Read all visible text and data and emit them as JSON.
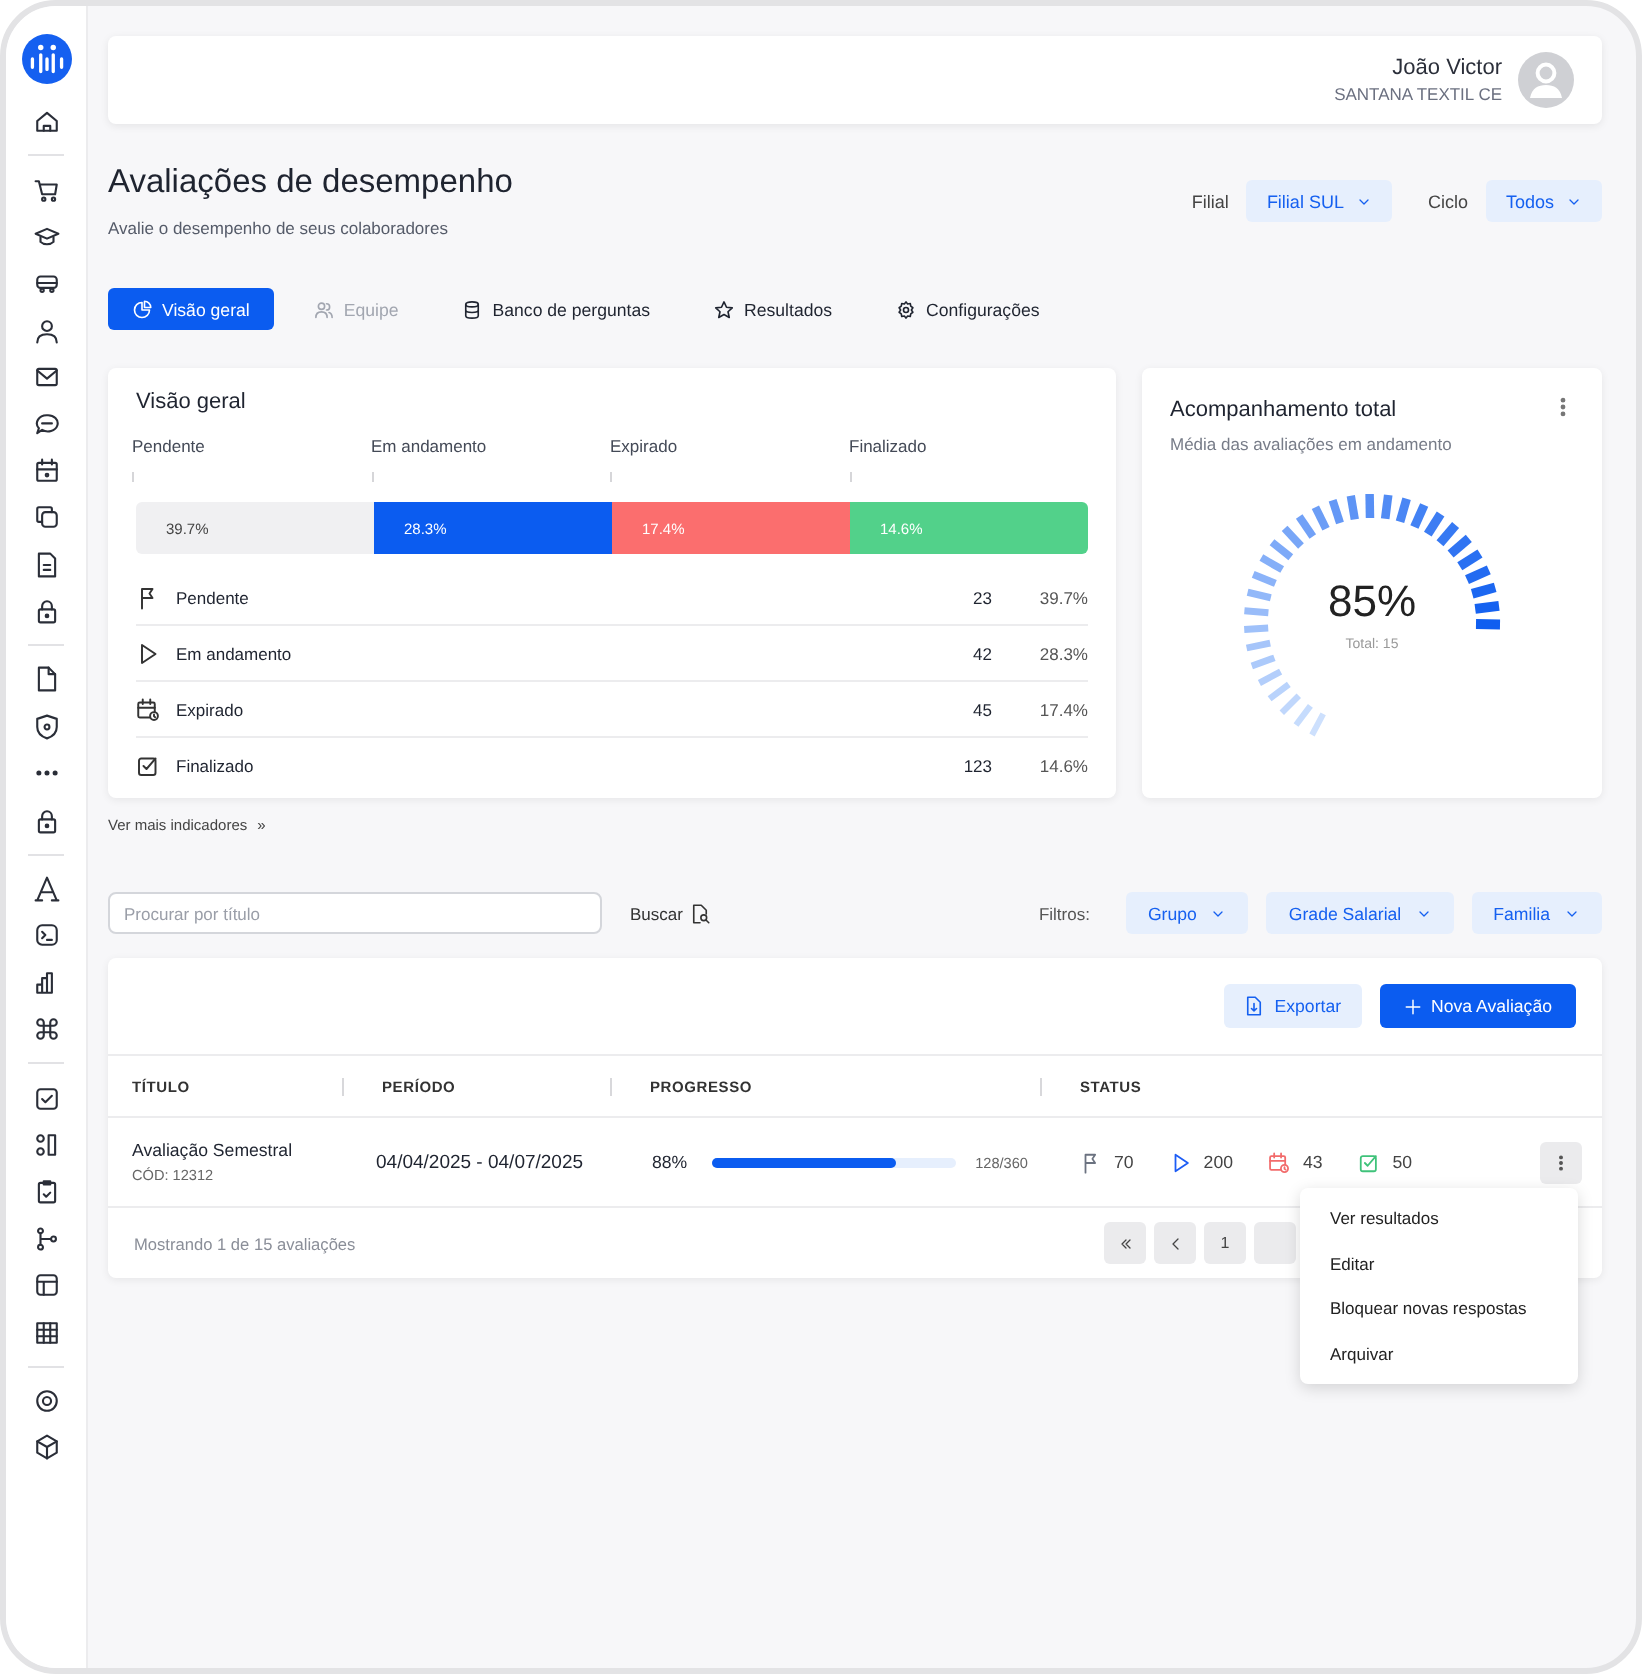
{
  "user": {
    "name": "João Victor",
    "company": "SANTANA TEXTIL CE"
  },
  "page": {
    "title": "Avaliações de desempenho",
    "subtitle": "Avalie o desempenho de seus colaboradores"
  },
  "selectors": [
    {
      "label": "Filial",
      "value": "Filial SUL"
    },
    {
      "label": "Ciclo",
      "value": "Todos"
    }
  ],
  "tabs": [
    {
      "label": "Visão geral",
      "selected": true,
      "disabled": false
    },
    {
      "label": "Equipe",
      "selected": false,
      "disabled": true
    },
    {
      "label": "Banco de perguntas",
      "selected": false,
      "disabled": false
    },
    {
      "label": "Resultados",
      "selected": false,
      "disabled": false
    },
    {
      "label": "Configurações",
      "selected": false,
      "disabled": false
    }
  ],
  "overview": {
    "title": "Visão geral",
    "segments": [
      {
        "label": "Pendente",
        "value": "39.7%",
        "color": "#f0f0f2"
      },
      {
        "label": "Em andamento",
        "value": "28.3%",
        "color": "#0b5cf0"
      },
      {
        "label": "Expirado",
        "value": "17.4%",
        "color": "#fb6e6e"
      },
      {
        "label": "Finalizado",
        "value": "14.6%",
        "color": "#52d18a"
      }
    ],
    "rows": [
      {
        "label": "Pendente",
        "count": "23",
        "percent": "39.7%"
      },
      {
        "label": "Em andamento",
        "count": "42",
        "percent": "28.3%"
      },
      {
        "label": "Expirado",
        "count": "45",
        "percent": "17.4%"
      },
      {
        "label": "Finalizado",
        "count": "123",
        "percent": "14.6%"
      }
    ]
  },
  "more_link": {
    "label": "Ver mais indicadores",
    "arrow": "»"
  },
  "tracking": {
    "title": "Acompanhamento total",
    "subtitle": "Média das avaliações em andamento",
    "value": "85%",
    "total": "Total: 15"
  },
  "search": {
    "placeholder": "Procurar por título",
    "button": "Buscar"
  },
  "filters": {
    "label": "Filtros:",
    "items": [
      "Grupo",
      "Grade Salarial",
      "Familia"
    ]
  },
  "table": {
    "actions": [
      {
        "label": "Exportar",
        "kind": "secondary"
      },
      {
        "label": "Nova Avaliação",
        "kind": "primary"
      }
    ],
    "columns": [
      "TÍTULO",
      "PERÍODO",
      "PROGRESSO",
      "STATUS"
    ],
    "rows": [
      {
        "title": "Avaliação Semestral",
        "code": "CÓD: 12312",
        "period": "04/04/2025 - 04/07/2025",
        "progress": "88%",
        "level": 0.76,
        "ratio": "128/360",
        "status": [
          {
            "count": "70",
            "color": "#6b7280"
          },
          {
            "count": "200",
            "color": "#1d5df5"
          },
          {
            "count": "43",
            "color": "#f26b6b"
          },
          {
            "count": "50",
            "color": "#3fc27a"
          }
        ]
      }
    ],
    "footer": "Mostrando 1 de 15 avaliações",
    "pages": [
      "1"
    ]
  },
  "menu": {
    "items": [
      "Ver resultados",
      "Editar",
      "Bloquear novas respostas",
      "Arquivar"
    ]
  }
}
